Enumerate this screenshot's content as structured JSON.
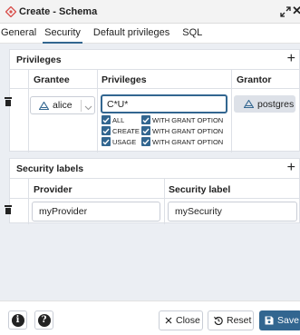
{
  "dialog": {
    "title": "Create - Schema"
  },
  "tabs": [
    {
      "label": "General",
      "active": false
    },
    {
      "label": "Security",
      "active": true
    },
    {
      "label": "Default privileges",
      "active": false
    },
    {
      "label": "SQL",
      "active": false
    }
  ],
  "privileges_section": {
    "title": "Privileges",
    "add_label": "+",
    "columns": {
      "grantee": "Grantee",
      "privileges": "Privileges",
      "grantor": "Grantor"
    },
    "row": {
      "grantee": "alice",
      "privileges_value": "C*U*",
      "options": [
        {
          "label": "ALL",
          "checked": true
        },
        {
          "label": "WITH GRANT OPTION",
          "checked": true
        },
        {
          "label": "CREATE",
          "checked": true
        },
        {
          "label": "WITH GRANT OPTION",
          "checked": true
        },
        {
          "label": "USAGE",
          "checked": true
        },
        {
          "label": "WITH GRANT OPTION",
          "checked": true
        }
      ],
      "grantor": "postgres"
    }
  },
  "security_labels_section": {
    "title": "Security labels",
    "add_label": "+",
    "columns": {
      "provider": "Provider",
      "security_label": "Security label"
    },
    "row": {
      "provider": "myProvider",
      "security_label": "mySecurity"
    }
  },
  "footer": {
    "info_label": "i",
    "help_label": "?",
    "close_label": "Close",
    "reset_label": "Reset",
    "save_label": "Save"
  },
  "colors": {
    "accent": "#326690",
    "panel_background": "#ebeef3",
    "title_icon": "#d9534f"
  }
}
